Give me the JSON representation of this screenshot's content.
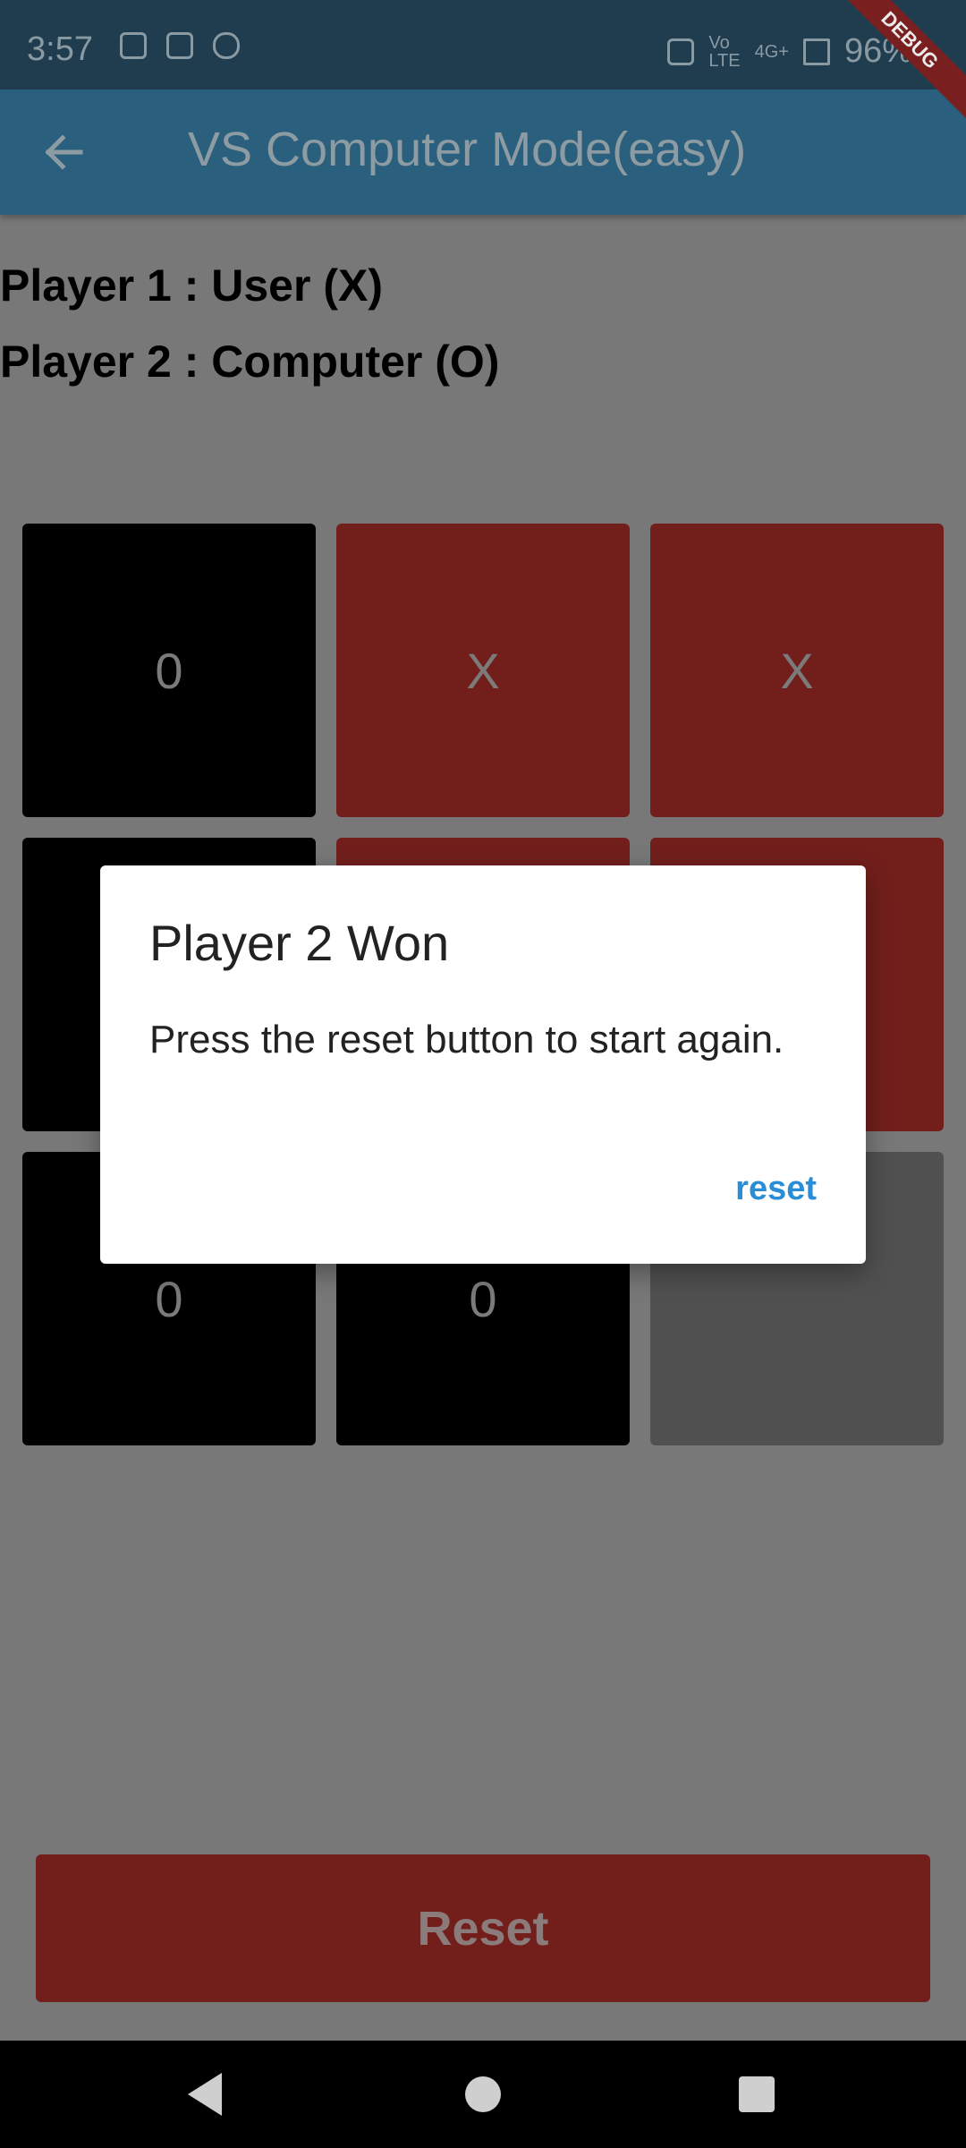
{
  "status_bar": {
    "time": "3:57",
    "network": "4G+",
    "battery": "96%",
    "icons": [
      "s-icon",
      "mail-icon",
      "glasses-icon",
      "vibrate-icon",
      "volte-icon",
      "signal-icon",
      "battery-icon"
    ]
  },
  "debug_ribbon": "DEBUG",
  "appbar": {
    "title": "VS Computer Mode(easy)",
    "back_icon": "arrow-left-icon"
  },
  "players": {
    "player1": "Player 1 : User (X)",
    "player2": "Player 2 : Computer (O)"
  },
  "board": {
    "cells": [
      {
        "mark": "0",
        "color": "#000000"
      },
      {
        "mark": "X",
        "color": "#721f1c"
      },
      {
        "mark": "X",
        "color": "#721f1c"
      },
      {
        "mark": "",
        "color": "#000000"
      },
      {
        "mark": "",
        "color": "#721f1c"
      },
      {
        "mark": "",
        "color": "#721f1c"
      },
      {
        "mark": "0",
        "color": "#000000"
      },
      {
        "mark": "0",
        "color": "#000000"
      },
      {
        "mark": "",
        "color": "#505050"
      }
    ]
  },
  "dialog": {
    "title": "Player 2 Won",
    "message": "Press the reset button to start again.",
    "action_label": "reset"
  },
  "reset_button": {
    "label": "Reset"
  },
  "colors": {
    "appbar": "#2a607e",
    "accent": "#2a8ed6",
    "red_cell": "#721f1c"
  }
}
